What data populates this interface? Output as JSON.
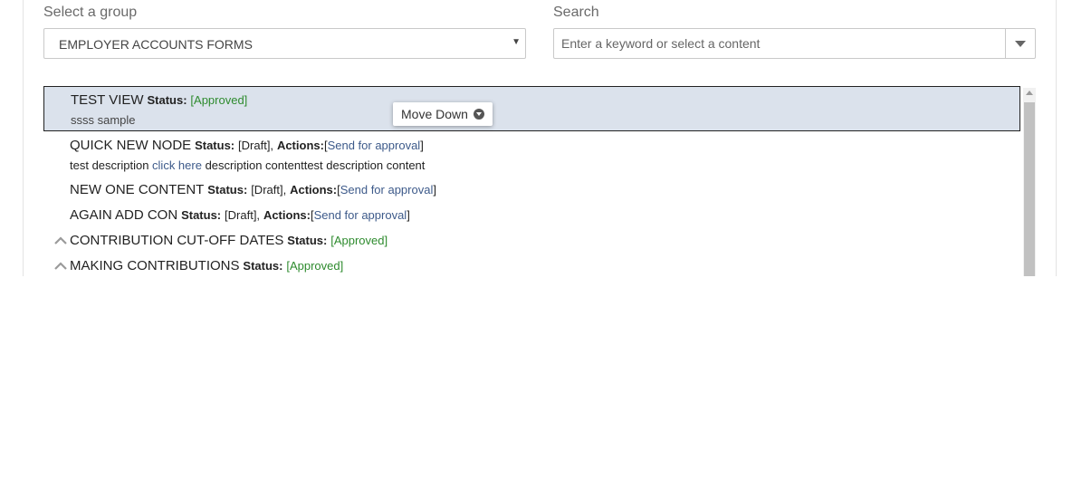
{
  "group_select": {
    "label": "Select a group",
    "value": "EMPLOYER ACCOUNTS FORMS"
  },
  "search": {
    "label": "Search",
    "placeholder": "Enter a keyword or select a content"
  },
  "tooltip": {
    "label": "Move Down"
  },
  "tree": {
    "status_label": "Status:",
    "actions_label": "Actions:",
    "items": [
      {
        "title": "TEST VIEW",
        "status": "[Approved]",
        "description": "ssss sample"
      },
      {
        "title": "QUICK NEW NODE",
        "status": "[Draft],",
        "action_open": "[",
        "action": "Send for approval",
        "action_close": "]",
        "desc_before": "test description ",
        "desc_link": "click here",
        "desc_after": " description contenttest description content"
      },
      {
        "title": "NEW ONE CONTENT",
        "status": "[Draft],",
        "action_open": "[",
        "action": "Send for approval",
        "action_close": "]"
      },
      {
        "title": "AGAIN ADD CON",
        "status": "[Draft],",
        "action_open": "[",
        "action": "Send for approval",
        "action_close": "]"
      },
      {
        "title": "CONTRIBUTION CUT-OFF DATES",
        "status": "[Approved]"
      },
      {
        "title": "MAKING CONTRIBUTIONS",
        "status": "[Approved]"
      }
    ]
  },
  "colors": {
    "approved": "#2e8b2e",
    "link": "#3d5a8a",
    "selected_bg": "#dbe2ec"
  }
}
